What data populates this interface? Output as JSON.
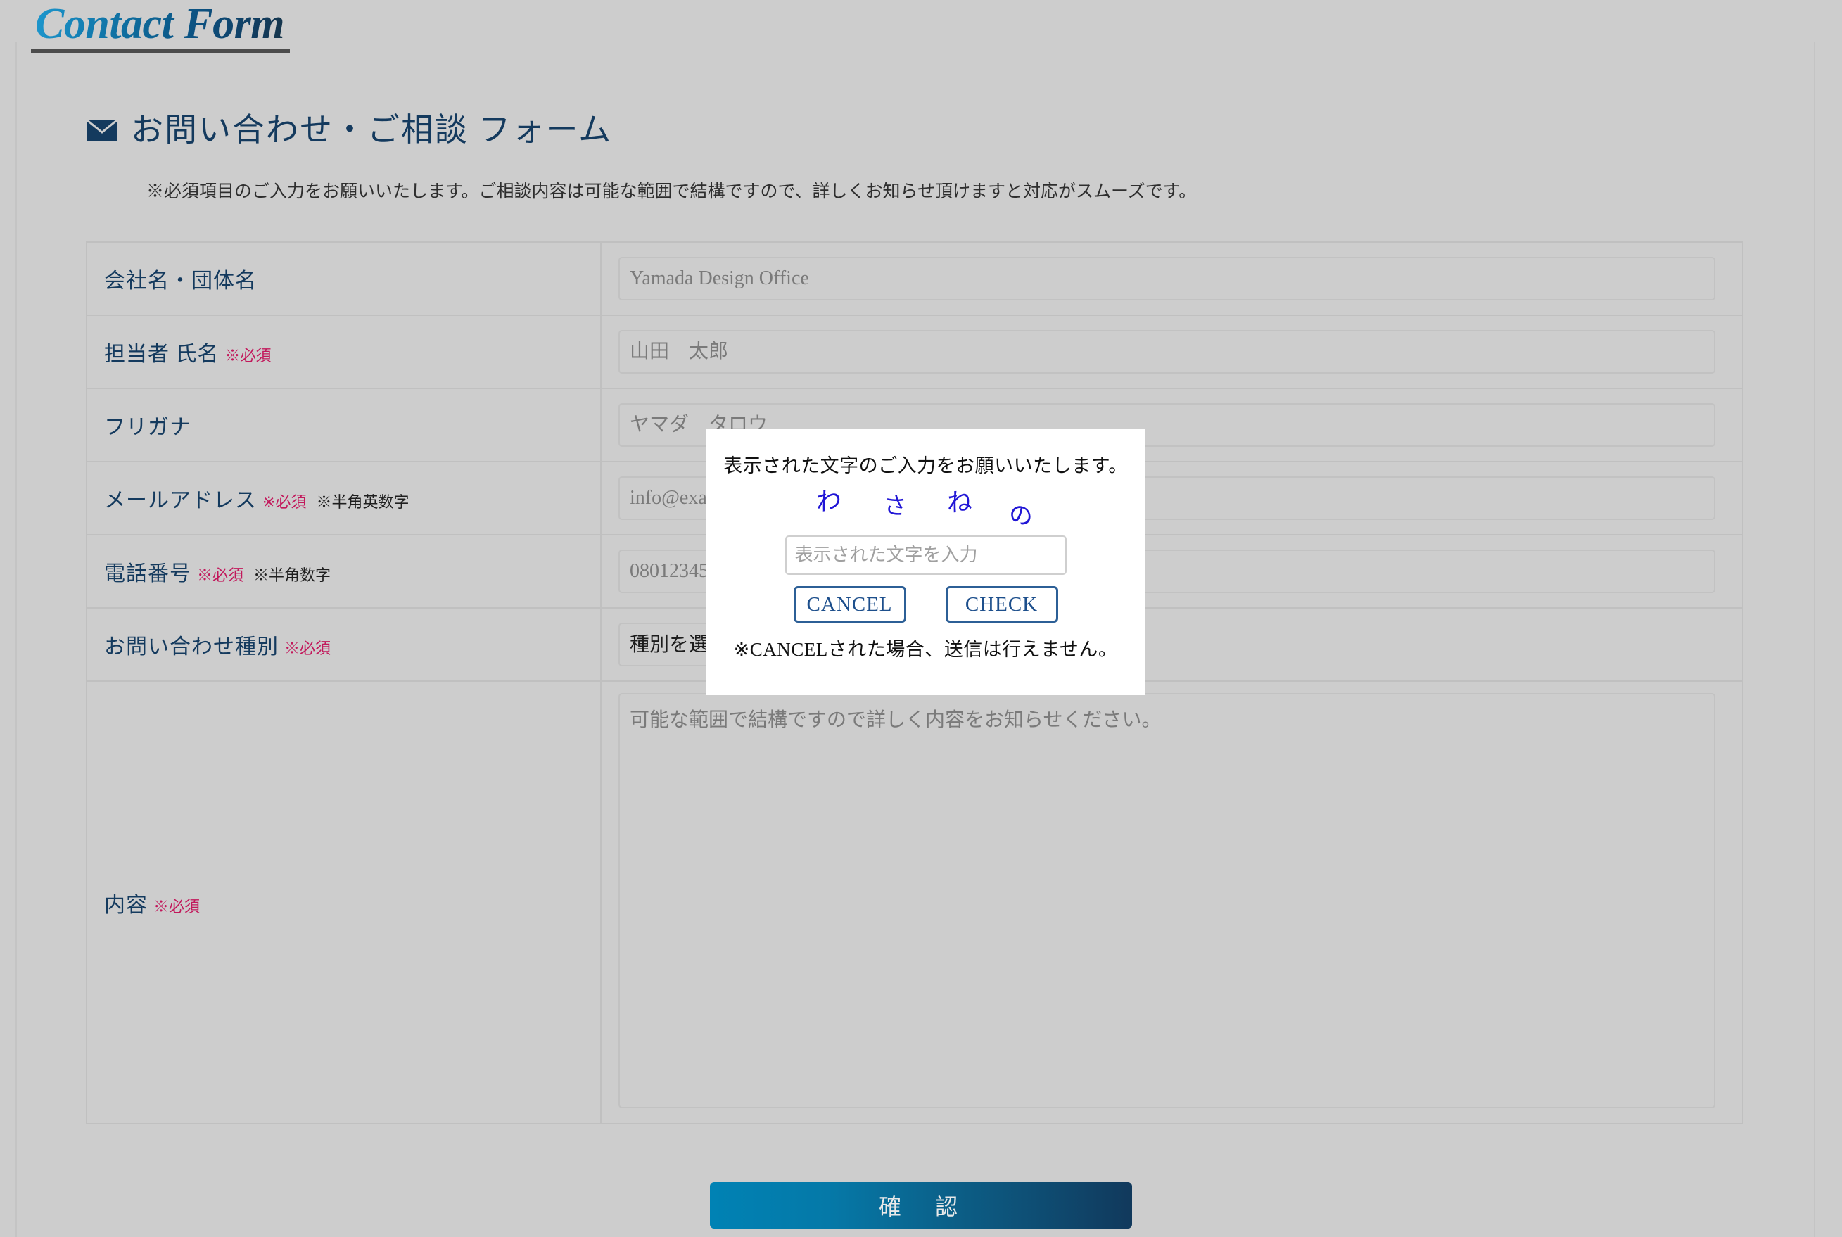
{
  "site": {
    "title": "Contact Form"
  },
  "heading": {
    "icon": "envelope-icon",
    "text": "お問い合わせ・ご相談 フォーム",
    "note": "※必須項目のご入力をお願いいたします。ご相談内容は可能な範囲で結構ですので、詳しくお知らせ頂けますと対応がスムーズです。"
  },
  "form": {
    "rows": [
      {
        "label": "会社名・団体名",
        "required_mark": "",
        "hint": "",
        "field_type": "text",
        "placeholder": "Yamada Design Office",
        "value": ""
      },
      {
        "label": "担当者 氏名",
        "required_mark": "※必須",
        "hint": "",
        "field_type": "text",
        "placeholder": "山田　太郎",
        "value": ""
      },
      {
        "label": "フリガナ",
        "required_mark": "",
        "hint": "",
        "field_type": "text",
        "placeholder": "ヤマダ　タロウ",
        "value": ""
      },
      {
        "label": "メールアドレス",
        "required_mark": "※必須",
        "hint": "※半角英数字",
        "field_type": "text",
        "placeholder": "info@example.com",
        "value": ""
      },
      {
        "label": "電話番号",
        "required_mark": "※必須",
        "hint": "※半角数字",
        "field_type": "text",
        "placeholder": "08012345678",
        "value": ""
      },
      {
        "label": "お問い合わせ種別",
        "required_mark": "※必須",
        "hint": "",
        "field_type": "select",
        "selected": "種別を選択...",
        "options": [
          "種別を選択..."
        ]
      },
      {
        "label": "内容",
        "required_mark": "※必須",
        "hint": "",
        "field_type": "textarea",
        "placeholder": "可能な範囲で結構ですので詳しく内容をお知らせください。",
        "value": ""
      }
    ],
    "submit_label": "確　認"
  },
  "captcha_modal": {
    "prompt": "表示された文字のご入力をお願いいたします。",
    "characters": [
      "わ",
      "さ",
      "ね",
      "の"
    ],
    "input_placeholder": "表示された文字を入力",
    "input_value": "",
    "cancel_label": "CANCEL",
    "check_label": "CHECK",
    "footnote": "※CANCELされた場合、送信は行えません。"
  },
  "colors": {
    "page_bg": "#cdcdcd",
    "heading_navy": "#143a5e",
    "required_crimson": "#c2185b",
    "captcha_blue": "#2116d6",
    "modal_button_blue": "#2c5f96",
    "submit_gradient_start": "#0082b4",
    "submit_gradient_end": "#11395c"
  }
}
